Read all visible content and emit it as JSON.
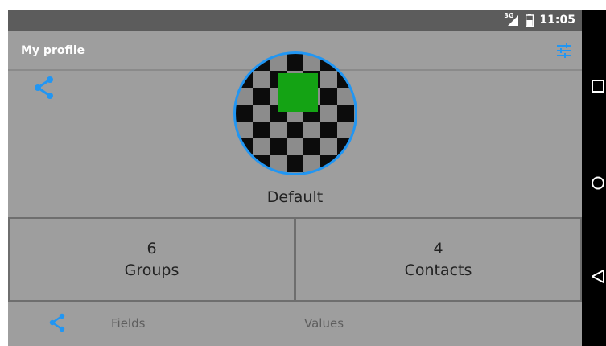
{
  "status_bar": {
    "network_label": "3G",
    "time": "11:05"
  },
  "app_bar": {
    "title": "My profile"
  },
  "profile": {
    "name": "Default"
  },
  "stats": {
    "groups_count": "6",
    "groups_label": "Groups",
    "contacts_count": "4",
    "contacts_label": "Contacts"
  },
  "table_header": {
    "fields": "Fields",
    "values": "Values"
  },
  "icons": {
    "settings": "tune-icon",
    "share": "share-icon",
    "battery": "battery-icon",
    "signal": "signal-icon",
    "recents": "square-icon",
    "home": "circle-icon",
    "back": "triangle-back-icon"
  },
  "colors": {
    "accent": "#2196f3",
    "avatar_square": "#14a314",
    "status_bar": "#5c5c5c",
    "surface": "#9e9e9e",
    "nav_bar": "#000000"
  }
}
